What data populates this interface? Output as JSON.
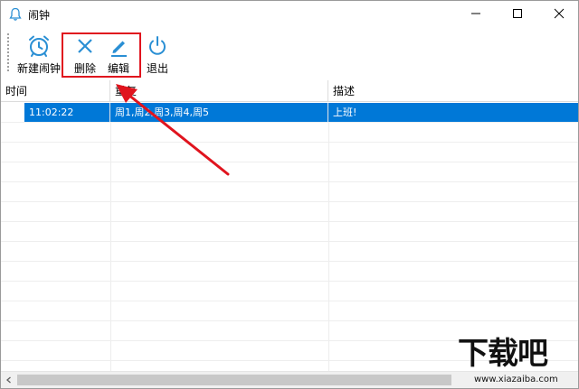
{
  "window": {
    "title": "闹钟",
    "controls": {
      "minimize_icon": "minimize-icon",
      "maximize_icon": "maximize-icon",
      "close_icon": "close-icon"
    }
  },
  "toolbar": {
    "new_label": "新建闹钟",
    "delete_label": "删除",
    "edit_label": "编辑",
    "exit_label": "退出"
  },
  "table": {
    "columns": [
      "时间",
      "重复",
      "描述"
    ],
    "rows": [
      {
        "time": "11:02:22",
        "repeat": "周1,周2,周3,周4,周5",
        "desc": "上班!"
      }
    ]
  },
  "colors": {
    "accent": "#2a8fd4",
    "selection": "#0078d7",
    "highlight": "#e0141e"
  },
  "watermark": {
    "big": "下载吧",
    "small": "www.xiazaiba.com"
  }
}
